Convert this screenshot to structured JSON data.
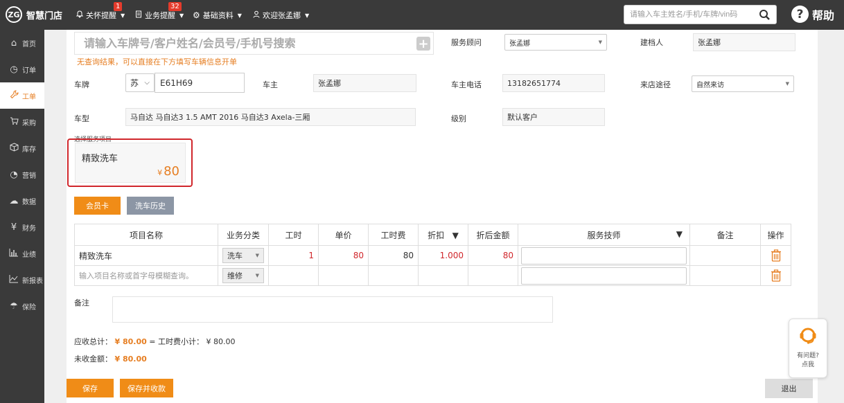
{
  "app": {
    "logo_mark": "ZG",
    "name": "智慧门店"
  },
  "topnav": {
    "items": [
      {
        "label": "关怀提醒",
        "badge": "1"
      },
      {
        "label": "业务提醒",
        "badge": "32"
      },
      {
        "label": "基础资料"
      },
      {
        "label": "欢迎张孟娜"
      }
    ],
    "search_placeholder": "请输入车主姓名/手机/车牌/vin码",
    "help_glyph": "?",
    "help_label": "帮助"
  },
  "sidebar": {
    "items": [
      {
        "label": "首页",
        "icon": "home-icon"
      },
      {
        "label": "订单",
        "icon": "clock-icon"
      },
      {
        "label": "工单",
        "icon": "wrench-icon",
        "active": true
      },
      {
        "label": "采购",
        "icon": "cart-icon"
      },
      {
        "label": "库存",
        "icon": "box-icon"
      },
      {
        "label": "营销",
        "icon": "pie-icon"
      },
      {
        "label": "数据",
        "icon": "cloud-icon"
      },
      {
        "label": "财务",
        "icon": "yen-icon"
      },
      {
        "label": "业绩",
        "icon": "bar-chart-icon"
      },
      {
        "label": "新报表",
        "icon": "line-chart-icon"
      },
      {
        "label": "保险",
        "icon": "umbrella-icon"
      }
    ]
  },
  "form": {
    "search_placeholder": "请输入车牌号/客户姓名/会员号/手机号搜索",
    "hint": "无查询结果，可以直接在下方填写车辆信息开单",
    "advisor_label": "服务顾问",
    "advisor_value": "张孟娜",
    "creator_label": "建档人",
    "creator_value": "张孟娜",
    "plate_label": "车牌",
    "plate_province": "苏",
    "plate_number": "E61H69",
    "owner_label": "车主",
    "owner_value": "张孟娜",
    "phone_label": "车主电话",
    "phone_value": "13182651774",
    "source_label": "来店途径",
    "source_value": "自然来访",
    "model_label": "车型",
    "model_value": "马自达 马自达3 1.5 AMT 2016 马自达3 Axela-三厢",
    "level_label": "级别",
    "level_value": "默认客户",
    "service_section_label": "选择服务项目"
  },
  "service_card": {
    "name": "精致洗车",
    "currency": "¥",
    "price": "80"
  },
  "buttons": {
    "member_card": "会员卡",
    "wash_history": "洗车历史",
    "save": "保存",
    "save_and_pay": "保存并收款",
    "exit": "退出"
  },
  "table": {
    "headers": [
      "项目名称",
      "业务分类",
      "工时",
      "单价",
      "工时费",
      "折扣",
      "折后金额",
      "服务技师",
      "备注",
      "操作"
    ],
    "sort_glyph": "▼",
    "rows": [
      {
        "name": "精致洗车",
        "category": "洗车",
        "hours": "1",
        "unit_price": "80",
        "labor_fee": "80",
        "discount": "1.000",
        "final_amount": "80"
      },
      {
        "name_placeholder": "输入项目名称或首字母模糊查询。",
        "category": "维修"
      }
    ]
  },
  "remark_label": "备注",
  "summary": {
    "receivable_label": "应收总计：",
    "receivable_value": "¥ 80.00",
    "receivable_suffix": "= 工时费小计： ¥ 80.00",
    "unpaid_label": "未收金额：",
    "unpaid_value": "¥ 80.00"
  },
  "float_help": {
    "line1": "有问题?",
    "line2": "点我"
  },
  "colors": {
    "accent": "#f08c17",
    "highlight_border": "#d0262b",
    "dark_bg": "#3a3a3a"
  }
}
